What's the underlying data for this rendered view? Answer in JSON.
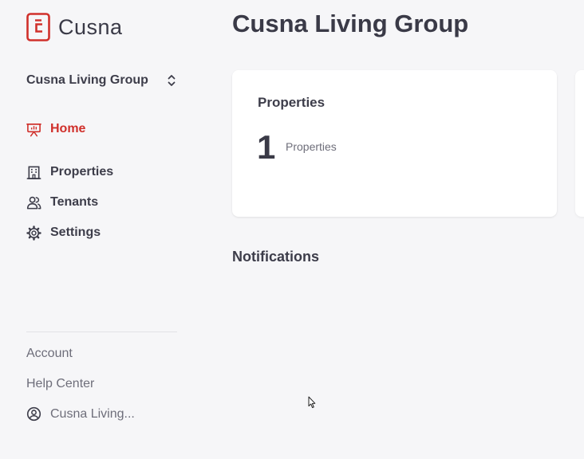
{
  "app": {
    "brand": "Cusna",
    "accent_color": "#d0302b"
  },
  "sidebar": {
    "org_switcher": {
      "label": "Cusna Living Group",
      "icon": "chevron-up-down-icon"
    },
    "nav": [
      {
        "label": "Home",
        "icon": "presentation-chart-icon",
        "active": true
      },
      {
        "label": "Properties",
        "icon": "building-icon",
        "active": false
      },
      {
        "label": "Tenants",
        "icon": "users-icon",
        "active": false
      },
      {
        "label": "Settings",
        "icon": "gear-icon",
        "active": false
      }
    ],
    "footer": {
      "account": "Account",
      "help": "Help Center",
      "user": {
        "label": "Cusna Living...",
        "icon": "user-circle-icon"
      }
    }
  },
  "main": {
    "title": "Cusna Living Group",
    "cards": [
      {
        "title": "Properties",
        "count": "1",
        "count_label": "Properties"
      }
    ],
    "notifications_title": "Notifications"
  }
}
